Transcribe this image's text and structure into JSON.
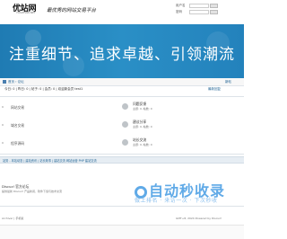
{
  "header": {
    "logo_text": "优站网",
    "logo_sub": "YOUZHAN.NET",
    "slogan": "最优秀的网站交易平台",
    "login": {
      "username_label": "用户名",
      "password_label": "密码"
    }
  },
  "banner": {
    "text": "注重细节、追求卓越、引领潮流"
  },
  "nav": {
    "breadcrumb": "首页 › 论坛",
    "right_link": "新帖"
  },
  "stats": {
    "text": "今日: 0 | 昨日: 0 | 帖子: 0 | 会员: 0 | 欢迎新会员 test1",
    "right": "最新回复"
  },
  "forums": {
    "left_rows": [
      {
        "title": "网站交易",
        "count": "0"
      },
      {
        "title": "域名交易",
        "count": "0"
      },
      {
        "title": "程序源码",
        "count": "0"
      }
    ],
    "right_rows": [
      {
        "title": "问题反馈",
        "sub": "主题: 0, 帖数: 0"
      },
      {
        "title": "建议分享",
        "sub": "主题: 0, 帖数: 0"
      },
      {
        "title": "站长交流",
        "sub": "主题: 0, 帖数: 0"
      }
    ]
  },
  "section2": {
    "title": "站务 - 本站动态 | 建站资讯 | 站长故事 | 建站交流  网站运营 PHP 建站交流",
    "item_title": "Discuz! 官方论坛",
    "item_desc": "提供最新 Discuz! 产品新闻、软件下载与技术交流",
    "footer_left": "Archiver | 手机版",
    "footer_right": "GMT+8, 2024 Powered by Discuz!"
  },
  "watermark": {
    "big": "自动秒收录",
    "small": "做上排名 · 来访一次 · 下次秒收"
  },
  "colors": {
    "banner": "#2a8fc6",
    "link": "#1a5f91",
    "watermark": "#2c8ee0"
  }
}
